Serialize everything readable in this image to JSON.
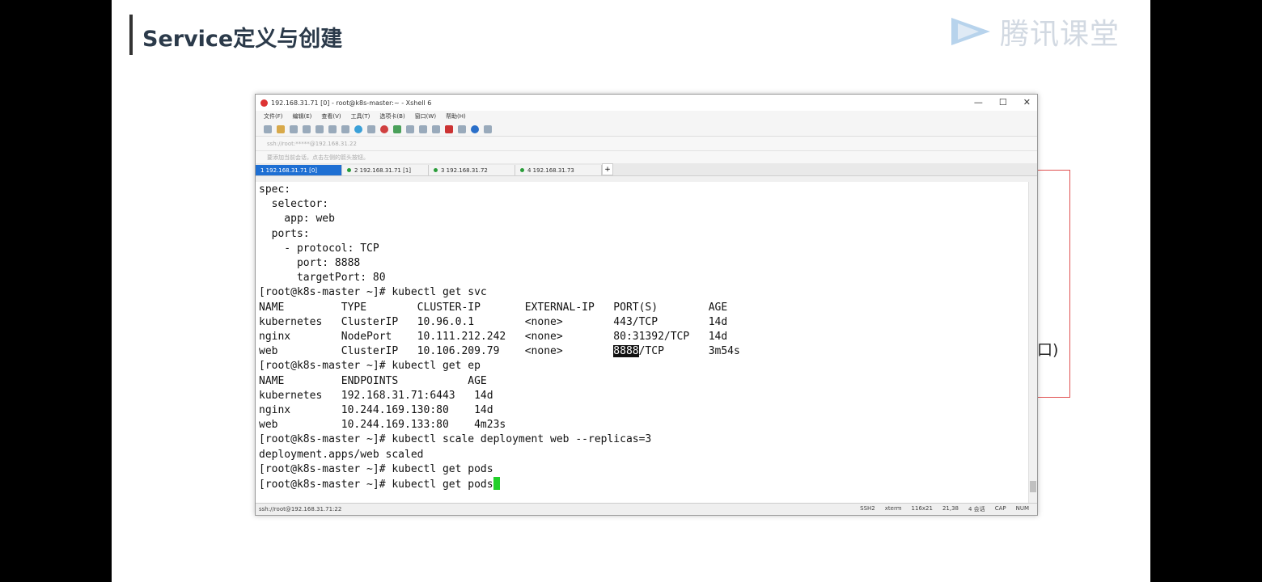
{
  "slide": {
    "title": "Service定义与创建",
    "logo_text": "腾讯课堂",
    "side_text": "口)"
  },
  "window": {
    "title": "192.168.31.71 [0] - root@k8s-master:~ - Xshell 6",
    "controls": [
      "—",
      "☐",
      "✕"
    ],
    "menu": [
      "文件(F)",
      "编辑(E)",
      "查看(V)",
      "工具(T)",
      "选项卡(B)",
      "窗口(W)",
      "帮助(H)"
    ],
    "address": "ssh://root:*****@192.168.31.22",
    "hint": "要添加当前会话，点击左侧的箭头按钮。",
    "tabs": [
      {
        "label": "1 192.168.31.71 [0]",
        "active": true
      },
      {
        "label": "2 192.168.31.71 [1]",
        "active": false
      },
      {
        "label": "3 192.168.31.72",
        "active": false
      },
      {
        "label": "4 192.168.31.73",
        "active": false
      }
    ],
    "tab_add": "+",
    "status_left": "ssh://root@192.168.31.71:22",
    "status_right": [
      "SSH2",
      "xterm",
      "116x21",
      "21,38",
      "4 会话",
      "CAP",
      "NUM"
    ]
  },
  "terminal": {
    "lines_before": [
      "spec:",
      "  selector:",
      "    app: web",
      "  ports:",
      "    - protocol: TCP",
      "      port: 8888",
      "      targetPort: 80",
      "[root@k8s-master ~]# kubectl get svc",
      "NAME         TYPE        CLUSTER-IP       EXTERNAL-IP   PORT(S)        AGE",
      "kubernetes   ClusterIP   10.96.0.1        <none>        443/TCP        14d",
      "nginx        NodePort    10.111.212.242   <none>        80:31392/TCP   14d"
    ],
    "web_row_prefix": "web          ClusterIP   10.106.209.79    <none>        ",
    "web_row_highlight": "8888",
    "web_row_suffix": "/TCP       3m54s",
    "lines_after": [
      "[root@k8s-master ~]# kubectl get ep",
      "NAME         ENDPOINTS           AGE",
      "kubernetes   192.168.31.71:6443   14d",
      "nginx        10.244.169.130:80    14d",
      "web          10.244.169.133:80    4m23s",
      "[root@k8s-master ~]# kubectl scale deployment web --replicas=3",
      "deployment.apps/web scaled",
      "[root@k8s-master ~]# kubectl get pods"
    ],
    "prompt_line": "[root@k8s-master ~]# kubectl get pods"
  }
}
